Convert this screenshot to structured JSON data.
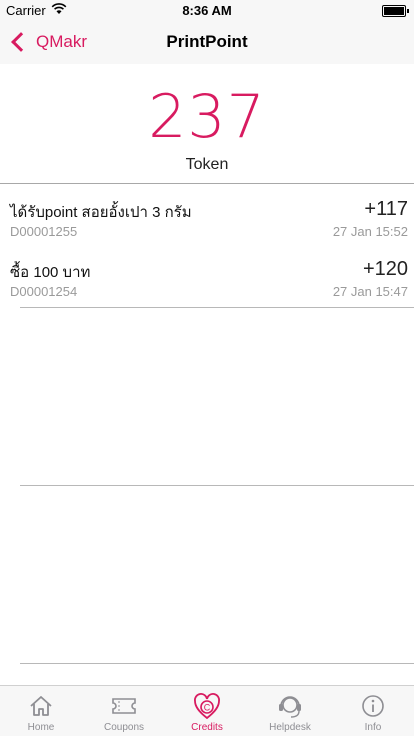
{
  "status_bar": {
    "carrier": "Carrier",
    "time": "8:36 AM"
  },
  "nav": {
    "back_label": "QMakr",
    "title": "PrintPoint"
  },
  "balance": {
    "value": "237",
    "unit": "Token"
  },
  "transactions": [
    {
      "title": "ได้รับpoint สอยอั้งเปา 3 กรัม",
      "code": "D00001255",
      "amount": "+117",
      "date": "27 Jan 15:52"
    },
    {
      "title": "ซื้อ 100 บาท",
      "code": "D00001254",
      "amount": "+120",
      "date": "27 Jan 15:47"
    }
  ],
  "tabs": [
    {
      "label": "Home",
      "icon": "home-icon"
    },
    {
      "label": "Coupons",
      "icon": "coupon-icon"
    },
    {
      "label": "Credits",
      "icon": "credits-icon",
      "active": true
    },
    {
      "label": "Helpdesk",
      "icon": "headset-icon"
    },
    {
      "label": "Info",
      "icon": "info-icon"
    }
  ],
  "colors": {
    "accent": "#d81b60",
    "muted": "#9a9a9a",
    "tab_inactive": "#8e8e93"
  }
}
